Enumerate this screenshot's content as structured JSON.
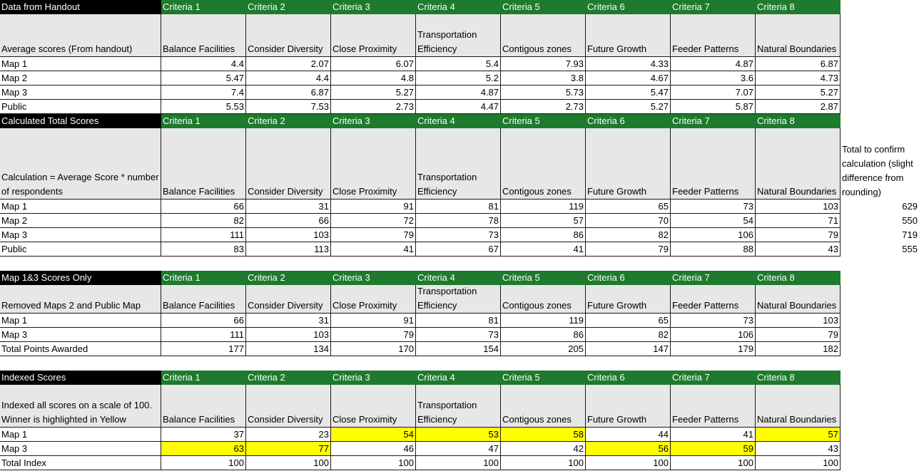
{
  "criteria_headers": [
    "Criteria 1",
    "Criteria 2",
    "Criteria 3",
    "Criteria 4",
    "Criteria 5",
    "Criteria 6",
    "Criteria 7",
    "Criteria 8"
  ],
  "criteria_names": [
    "Balance Facilities",
    "Consider Diversity",
    "Close Proximity",
    "Transportation Efficiency",
    "Contigous zones",
    "Future Growth",
    "Feeder Patterns",
    "Natural Boundaries"
  ],
  "colors": {
    "title_bg": "#000000",
    "header_bg": "#1e7a2d",
    "subheader_bg": "#e7e7e7",
    "highlight": "#ffff00"
  },
  "sections": [
    {
      "title": "Data from Handout",
      "sublabel": "Average scores (From handout)",
      "rows": [
        {
          "label": "Map 1",
          "values": [
            "4.4",
            "2.07",
            "6.07",
            "5.4",
            "7.93",
            "4.33",
            "4.87",
            "6.87"
          ],
          "highlight": [
            false,
            false,
            false,
            false,
            false,
            false,
            false,
            false
          ]
        },
        {
          "label": "Map 2",
          "values": [
            "5.47",
            "4.4",
            "4.8",
            "5.2",
            "3.8",
            "4.67",
            "3.6",
            "4.73"
          ],
          "highlight": [
            false,
            false,
            false,
            false,
            false,
            false,
            false,
            false
          ]
        },
        {
          "label": "Map 3",
          "values": [
            "7.4",
            "6.87",
            "5.27",
            "4.87",
            "5.73",
            "5.47",
            "7.07",
            "5.27"
          ],
          "highlight": [
            false,
            false,
            false,
            false,
            false,
            false,
            false,
            false
          ]
        },
        {
          "label": "Public",
          "values": [
            "5.53",
            "7.53",
            "2.73",
            "4.47",
            "2.73",
            "5.27",
            "5.87",
            "2.87"
          ],
          "highlight": [
            false,
            false,
            false,
            false,
            false,
            false,
            false,
            false
          ]
        }
      ]
    },
    {
      "title": "Calculated Total Scores",
      "sublabel": "Calculation = Average Score * number of respondents",
      "total_header": "Total to confirm calculation (slight difference from rounding)",
      "rows": [
        {
          "label": "Map 1",
          "values": [
            "66",
            "31",
            "91",
            "81",
            "119",
            "65",
            "73",
            "103"
          ],
          "total": "629",
          "highlight": [
            false,
            false,
            false,
            false,
            false,
            false,
            false,
            false
          ]
        },
        {
          "label": "Map 2",
          "values": [
            "82",
            "66",
            "72",
            "78",
            "57",
            "70",
            "54",
            "71"
          ],
          "total": "550",
          "highlight": [
            false,
            false,
            false,
            false,
            false,
            false,
            false,
            false
          ]
        },
        {
          "label": "Map 3",
          "values": [
            "111",
            "103",
            "79",
            "73",
            "86",
            "82",
            "106",
            "79"
          ],
          "total": "719",
          "highlight": [
            false,
            false,
            false,
            false,
            false,
            false,
            false,
            false
          ]
        },
        {
          "label": "Public",
          "values": [
            "83",
            "113",
            "41",
            "67",
            "41",
            "79",
            "88",
            "43"
          ],
          "total": "555",
          "highlight": [
            false,
            false,
            false,
            false,
            false,
            false,
            false,
            false
          ]
        }
      ]
    },
    {
      "title": "Map 1&3 Scores Only",
      "sublabel": "Removed Maps 2 and Public Map",
      "rows": [
        {
          "label": "Map 1",
          "values": [
            "66",
            "31",
            "91",
            "81",
            "119",
            "65",
            "73",
            "103"
          ],
          "highlight": [
            false,
            false,
            false,
            false,
            false,
            false,
            false,
            false
          ]
        },
        {
          "label": "Map 3",
          "values": [
            "111",
            "103",
            "79",
            "73",
            "86",
            "82",
            "106",
            "79"
          ],
          "highlight": [
            false,
            false,
            false,
            false,
            false,
            false,
            false,
            false
          ]
        },
        {
          "label": "Total Points Awarded",
          "values": [
            "177",
            "134",
            "170",
            "154",
            "205",
            "147",
            "179",
            "182"
          ],
          "highlight": [
            false,
            false,
            false,
            false,
            false,
            false,
            false,
            false
          ]
        }
      ]
    },
    {
      "title": "Indexed Scores",
      "sublabel": "Indexed all scores on a scale of 100. Winner is highlighted in Yellow",
      "rows": [
        {
          "label": "Map 1",
          "values": [
            "37",
            "23",
            "54",
            "53",
            "58",
            "44",
            "41",
            "57"
          ],
          "highlight": [
            false,
            false,
            true,
            true,
            true,
            false,
            false,
            true
          ]
        },
        {
          "label": "Map 3",
          "values": [
            "63",
            "77",
            "46",
            "47",
            "42",
            "56",
            "59",
            "43"
          ],
          "highlight": [
            true,
            true,
            false,
            false,
            false,
            true,
            true,
            false
          ]
        },
        {
          "label": "Total Index",
          "values": [
            "100",
            "100",
            "100",
            "100",
            "100",
            "100",
            "100",
            "100"
          ],
          "highlight": [
            false,
            false,
            false,
            false,
            false,
            false,
            false,
            false
          ]
        }
      ]
    }
  ]
}
